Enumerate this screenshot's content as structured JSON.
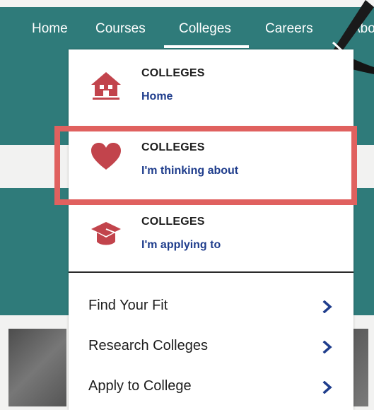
{
  "nav": {
    "items": [
      {
        "label": "Home"
      },
      {
        "label": "Courses"
      },
      {
        "label": "Colleges"
      },
      {
        "label": "Careers"
      },
      {
        "label": "Abou"
      }
    ],
    "active": "Colleges"
  },
  "dropdown": {
    "items": [
      {
        "title": "COLLEGES",
        "subtitle": "Home",
        "icon": "house-icon"
      },
      {
        "title": "COLLEGES",
        "subtitle": "I'm thinking about",
        "icon": "heart-icon",
        "highlighted": true
      },
      {
        "title": "COLLEGES",
        "subtitle": "I'm applying to",
        "icon": "graduation-cap-icon"
      }
    ],
    "links": [
      {
        "label": "Find Your Fit"
      },
      {
        "label": "Research Colleges"
      },
      {
        "label": "Apply to College"
      }
    ]
  },
  "colors": {
    "brand_teal": "#2f7b7a",
    "icon_red": "#c2444c",
    "link_blue": "#1f3d8c",
    "highlight": "#e0615f"
  }
}
